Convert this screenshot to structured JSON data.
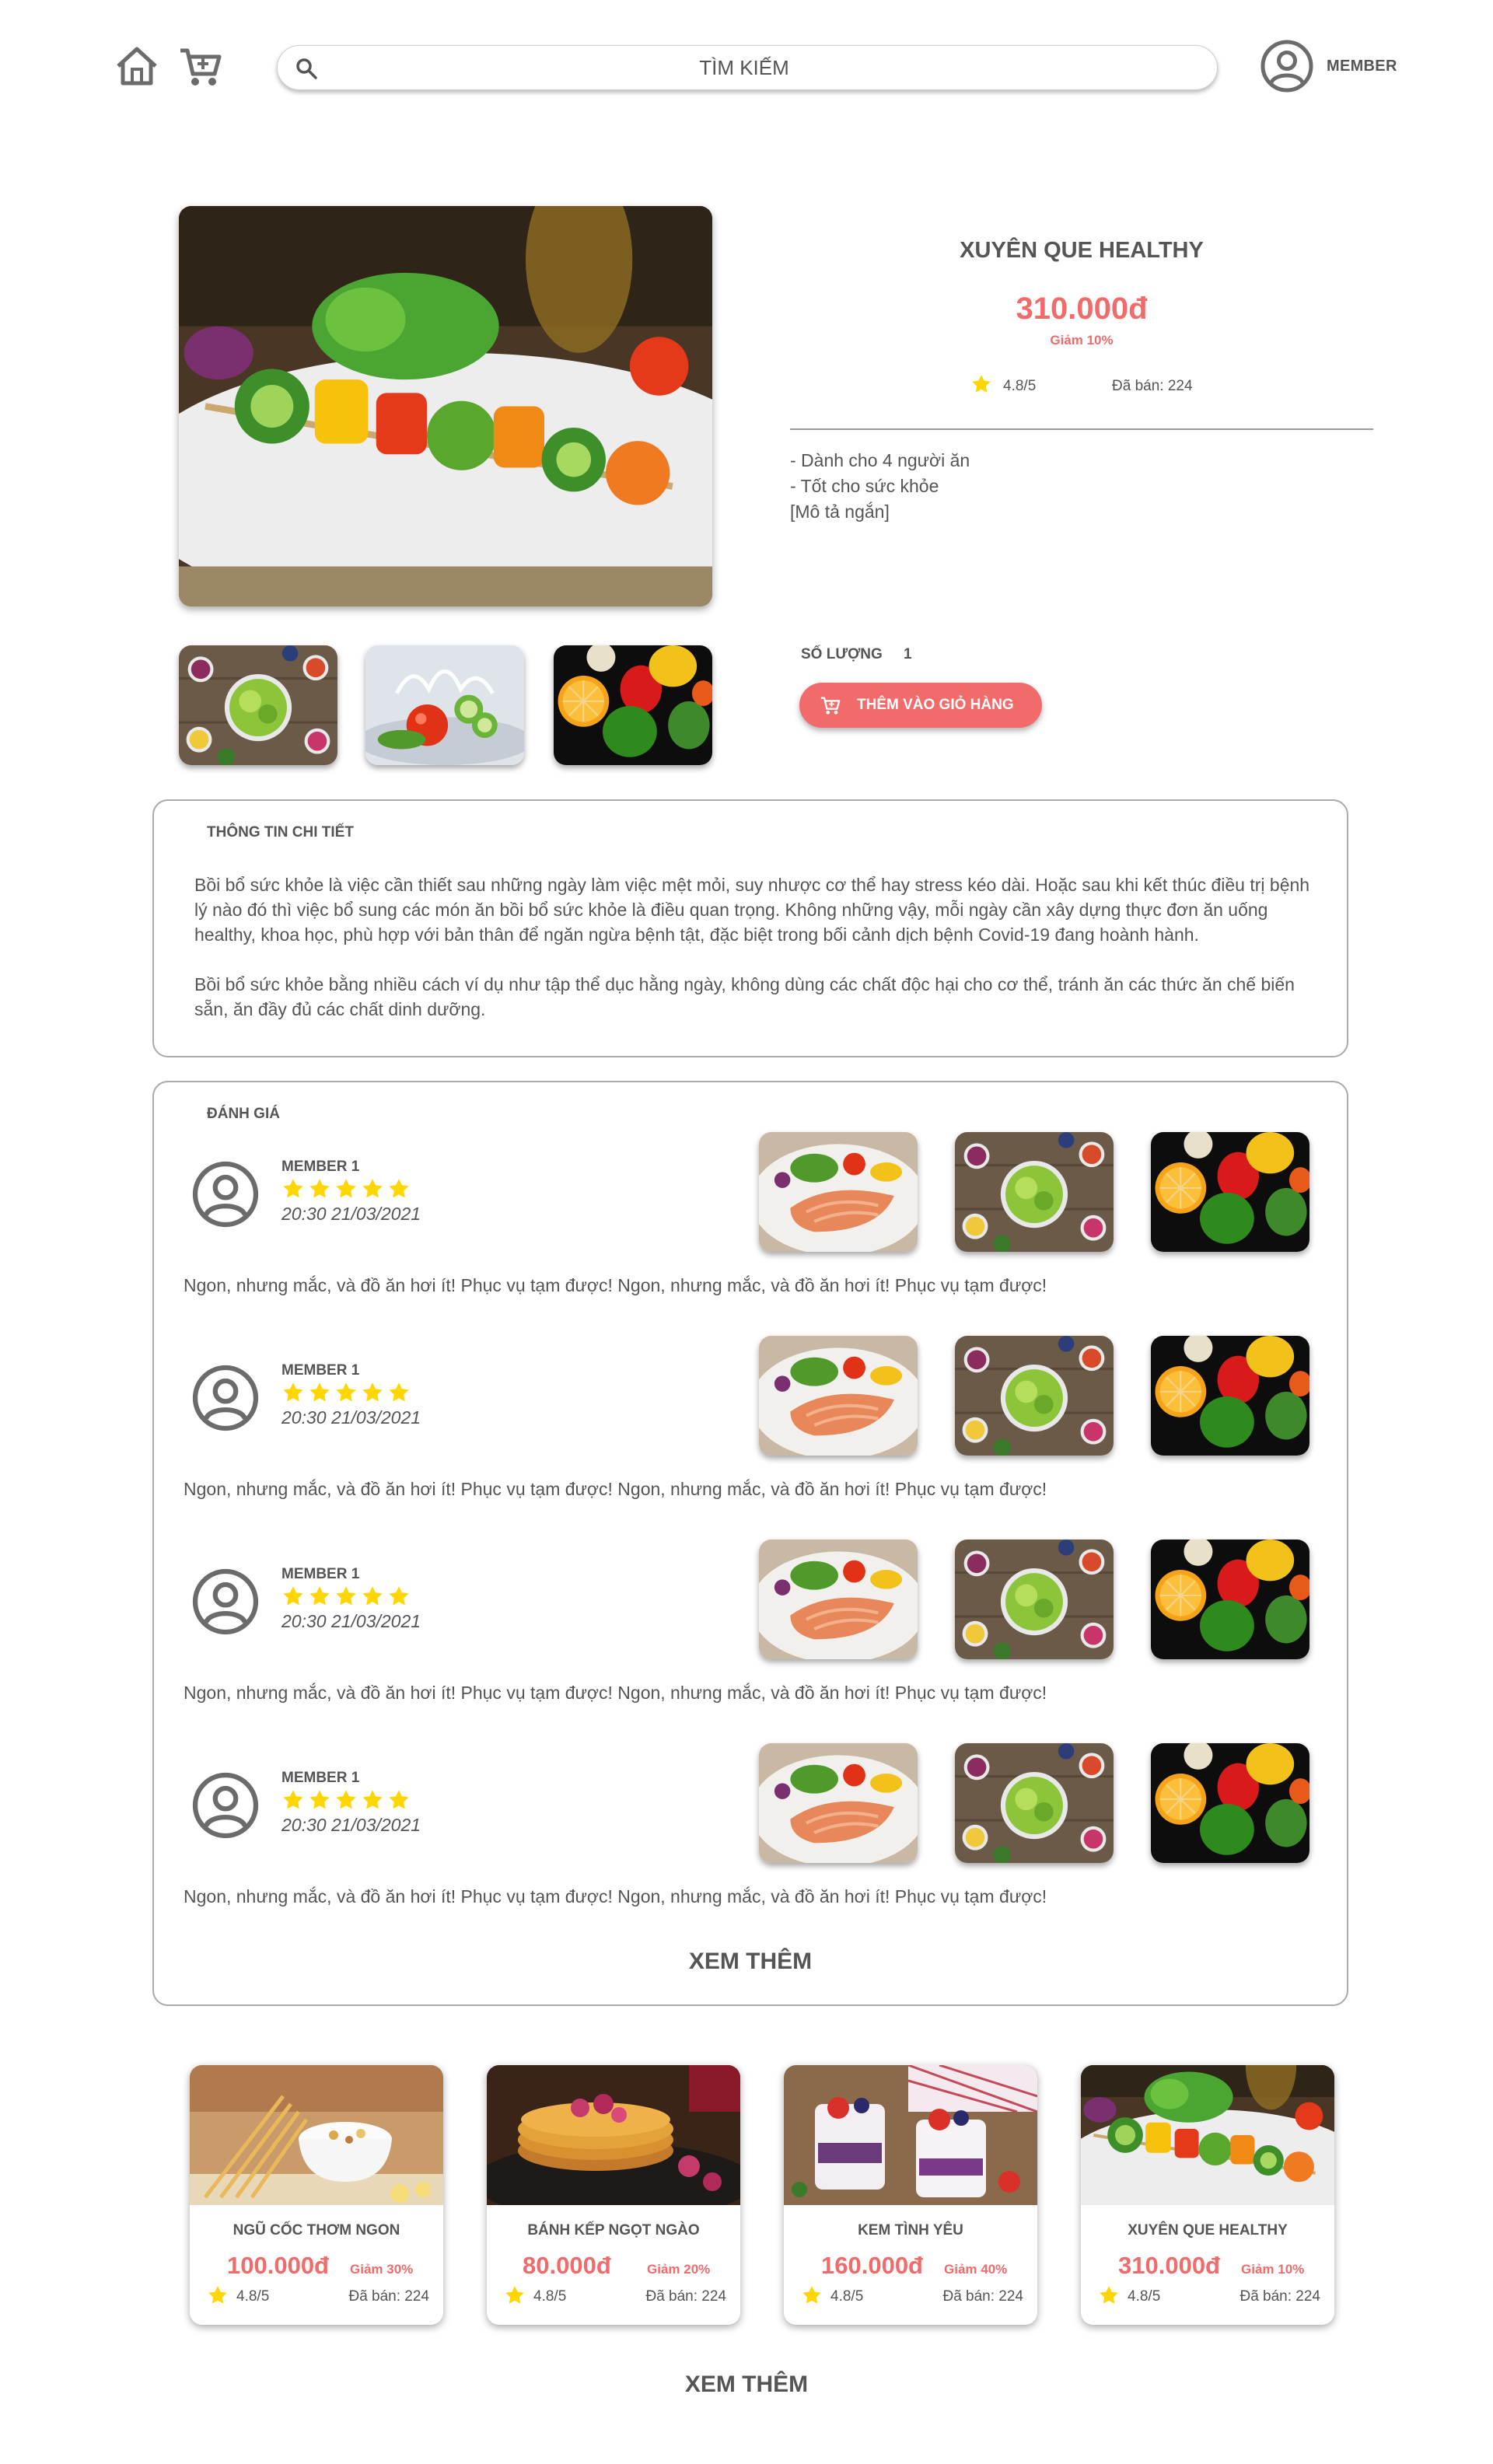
{
  "search": {
    "placeholder": "TÌM KIẾM"
  },
  "user": {
    "label": "MEMBER"
  },
  "product": {
    "name": "XUYÊN QUE HEALTHY",
    "price": "310.000đ",
    "discount": "Giảm 10%",
    "rating": "4.8/5",
    "sold": "Đã bán: 224",
    "description": [
      "- Dành cho 4 người ăn",
      "- Tốt cho sức khỏe",
      "[Mô tả ngắn]"
    ],
    "quantity_label": "SỐ LƯỢNG",
    "quantity": "1",
    "add_to_cart": "THÊM VÀO GIỎ HÀNG"
  },
  "details": {
    "title": "THÔNG TIN CHI TIẾT",
    "paragraphs": [
      "Bồi bổ sức khỏe là việc cần thiết sau những ngày làm việc mệt mỏi, suy nhược cơ thể hay stress kéo dài. Hoặc sau khi kết thúc điều trị bệnh lý nào đó thì việc bổ sung các món ăn bồi bổ sức khỏe là điều quan trọng. Không những vậy, mỗi ngày cần xây dựng thực đơn ăn uống healthy, khoa học, phù hợp với bản thân để ngăn ngừa bệnh tật, đặc biệt trong bối cảnh dịch bệnh Covid-19 đang hoành hành.",
      "Bồi bổ sức khỏe bằng nhiều cách ví dụ như tập thể dục hằng ngày, không dùng các chất độc hại cho cơ thể, tránh ăn các thức ăn chế biến sẵn, ăn đầy đủ các chất dinh dưỡng."
    ]
  },
  "reviews": {
    "title": "ĐÁNH GIÁ",
    "items": [
      {
        "name": "MEMBER 1",
        "stars": 5,
        "time": "20:30 21/03/2021",
        "text": "Ngon, nhưng mắc, và đồ ăn hơi ít! Phục vụ tạm được! Ngon, nhưng mắc, và đồ ăn hơi ít! Phục vụ tạm được!"
      },
      {
        "name": "MEMBER 1",
        "stars": 5,
        "time": "20:30 21/03/2021",
        "text": "Ngon, nhưng mắc, và đồ ăn hơi ít! Phục vụ tạm được! Ngon, nhưng mắc, và đồ ăn hơi ít! Phục vụ tạm được!"
      },
      {
        "name": "MEMBER 1",
        "stars": 5,
        "time": "20:30 21/03/2021",
        "text": "Ngon, nhưng mắc, và đồ ăn hơi ít! Phục vụ tạm được! Ngon, nhưng mắc, và đồ ăn hơi ít! Phục vụ tạm được!"
      },
      {
        "name": "MEMBER 1",
        "stars": 5,
        "time": "20:30 21/03/2021",
        "text": "Ngon, nhưng mắc, và đồ ăn hơi ít! Phục vụ tạm được! Ngon, nhưng mắc, và đồ ăn hơi ít! Phục vụ tạm được!"
      }
    ],
    "see_more": "XEM THÊM"
  },
  "related": [
    {
      "name": "NGŨ CỐC THƠM NGON",
      "price": "100.000đ",
      "discount": "Giảm 30%",
      "rating": "4.8/5",
      "sold": "Đã bán: 224"
    },
    {
      "name": "BÁNH KẾP NGỌT NGÀO",
      "price": "80.000đ",
      "discount": "Giảm 20%",
      "rating": "4.8/5",
      "sold": "Đã bán: 224"
    },
    {
      "name": "KEM TÌNH YÊU",
      "price": "160.000đ",
      "discount": "Giảm 40%",
      "rating": "4.8/5",
      "sold": "Đã bán: 224"
    },
    {
      "name": "XUYÊN QUE HEALTHY",
      "price": "310.000đ",
      "discount": "Giảm 10%",
      "rating": "4.8/5",
      "sold": "Đã bán: 224"
    }
  ],
  "see_more_bottom": "XEM THÊM",
  "colors": {
    "accent": "#f26b6b",
    "star": "#ffd600",
    "text": "#555555",
    "border": "#aaaaaa"
  },
  "icons": [
    "home-icon",
    "cart-icon",
    "search-icon",
    "user-icon",
    "star-icon",
    "add-cart-icon"
  ]
}
